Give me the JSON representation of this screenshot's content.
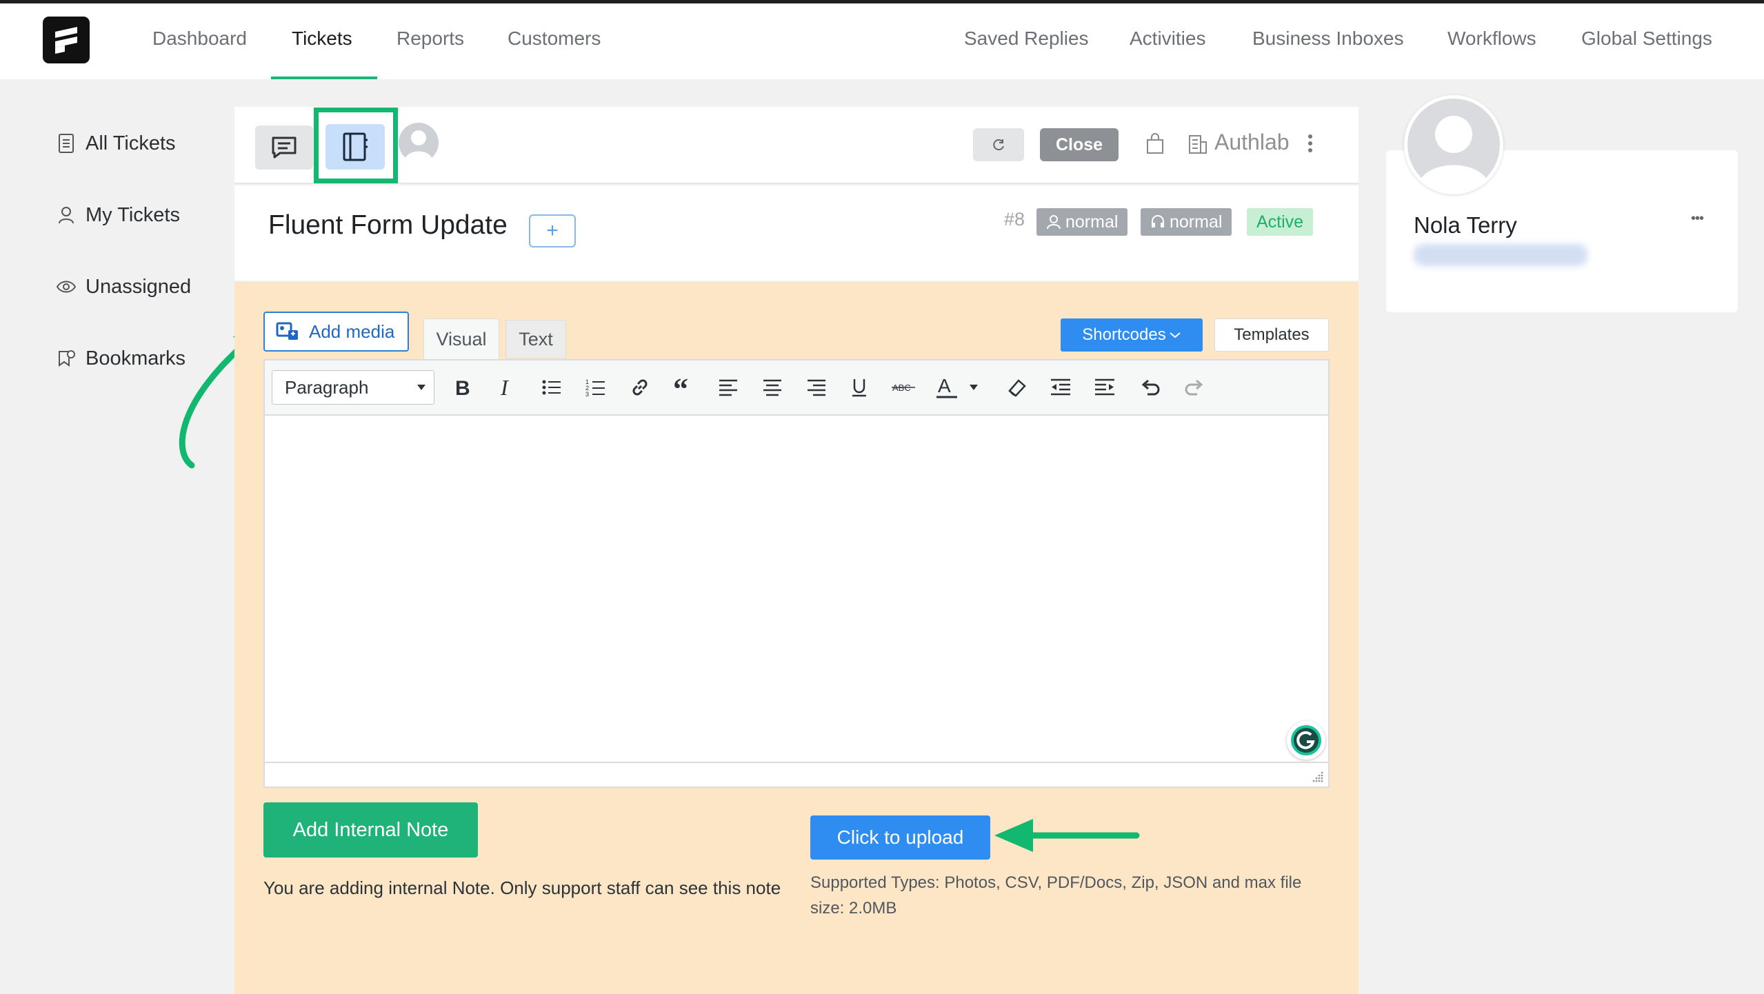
{
  "colors": {
    "accent_green": "#1fb37a",
    "primary_blue": "#2f8cf0",
    "editor_bg": "#fde6c6",
    "highlight_green": "#12b870"
  },
  "nav": {
    "left": [
      "Dashboard",
      "Tickets",
      "Reports",
      "Customers"
    ],
    "right": [
      "Saved Replies",
      "Activities",
      "Business Inboxes",
      "Workflows",
      "Global Settings"
    ],
    "active": "Tickets"
  },
  "sidebar": {
    "items": [
      {
        "label": "All Tickets",
        "icon": "list-icon"
      },
      {
        "label": "My Tickets",
        "icon": "user-icon"
      },
      {
        "label": "Unassigned",
        "icon": "eye-icon"
      },
      {
        "label": "Bookmarks",
        "icon": "bookmark-icon"
      }
    ]
  },
  "ticket": {
    "title": "Fluent Form Update",
    "add_label": "+",
    "number": "#8",
    "priority_customer": "normal",
    "priority_agent": "normal",
    "status": "Active",
    "close_label": "Close",
    "mailbox": "Authlab"
  },
  "editor": {
    "add_media": "Add media",
    "tab_visual": "Visual",
    "tab_text": "Text",
    "shortcodes": "Shortcodes",
    "templates": "Templates",
    "format_select": "Paragraph"
  },
  "actions": {
    "add_note": "Add Internal Note",
    "note_help": "You are adding internal Note. Only support staff can see this note",
    "upload": "Click to upload",
    "upload_help": "Supported Types: Photos, CSV, PDF/Docs, Zip, JSON and max file size: 2.0MB"
  },
  "customer": {
    "name": "Nola Terry",
    "more": "•••"
  }
}
